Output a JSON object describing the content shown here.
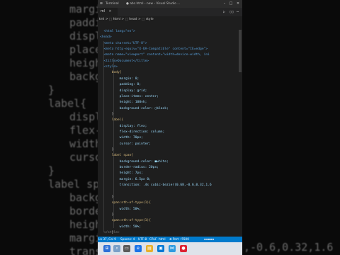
{
  "background": {
    "left_lines": [
      "margi",
      "paddi",
      "displ",
      "place",
      "heigh",
      "backg",
      "}",
      "label{",
      "displ",
      "flex-",
      "width",
      "curso",
      "}",
      "label span",
      "backg",
      "borde",
      "heigh",
      "margi",
      "trans"
    ],
    "right_lines": [
      ",-0.6,0.32,1.6"
    ]
  },
  "titlebar": {
    "menu": "Terminal",
    "title": "● abc.html - new - Visual Studio ...",
    "controls": [
      "–",
      "□",
      "✕"
    ]
  },
  "tab": {
    "label": "ml",
    "close": "×"
  },
  "breadcrumb": "tml > ⬚ html > ⬚ head > ⬚ style",
  "code": [
    {
      "t": "  <html lang=\"en\">"
    },
    {
      "t": "<head>"
    },
    {
      "t": "  <meta charset=\"UTF-8\">"
    },
    {
      "t": "  <meta http-equiv=\"X-UA-Compatible\" content=\"IE=edge\">"
    },
    {
      "t": "  <meta name=\"viewport\" content=\"width=device-width, ini"
    },
    {
      "t": "  <title>Document</title>"
    },
    {
      "t": "  <style>"
    },
    {
      "t": "      body{"
    },
    {
      "t": "          margin: 0;"
    },
    {
      "t": "          padding: 0;"
    },
    {
      "t": "          display: grid;"
    },
    {
      "t": "          place-items: center;"
    },
    {
      "t": "          height: 100vh;"
    },
    {
      "t": "          background-color: ▢black;"
    },
    {
      "t": "      }"
    },
    {
      "t": "      label{"
    },
    {
      "t": "          display: flex;"
    },
    {
      "t": "          flex-direction: column;"
    },
    {
      "t": "          width: 70px;"
    },
    {
      "t": "          cursor: pointer;"
    },
    {
      "t": "      }"
    },
    {
      "t": "      label span{"
    },
    {
      "t": "          background-color: ■white;"
    },
    {
      "t": "          border-radius: 20px;"
    },
    {
      "t": "          height: 7px;"
    },
    {
      "t": "          margin: 6.5px 0;"
    },
    {
      "t": "          transition: .4s cubic-bezier(0.68,-0.6,0.32,1.6"
    },
    {
      "t": ""
    },
    {
      "t": "      }"
    },
    {
      "t": "      span:nth-of-type(1){"
    },
    {
      "t": "          width: 50%;"
    },
    {
      "t": "      }"
    },
    {
      "t": "      span:nth-of-type(1){"
    },
    {
      "t": "          width: 50%;"
    },
    {
      "t": "      }"
    }
  ],
  "closing_line": "  </style>",
  "status": {
    "position": "Ln 37, Col 9",
    "spaces": "Spaces: 4",
    "encoding": "UTF-8",
    "eol": "CRLF",
    "language": "html",
    "port": "⊕ Port : 5500"
  },
  "taskbar": {
    "time": "",
    "date": ""
  },
  "colors": {
    "editor_bg": "#1e1e1e",
    "status_bar": "#007acc",
    "taskbar": "#dfe3ea"
  }
}
